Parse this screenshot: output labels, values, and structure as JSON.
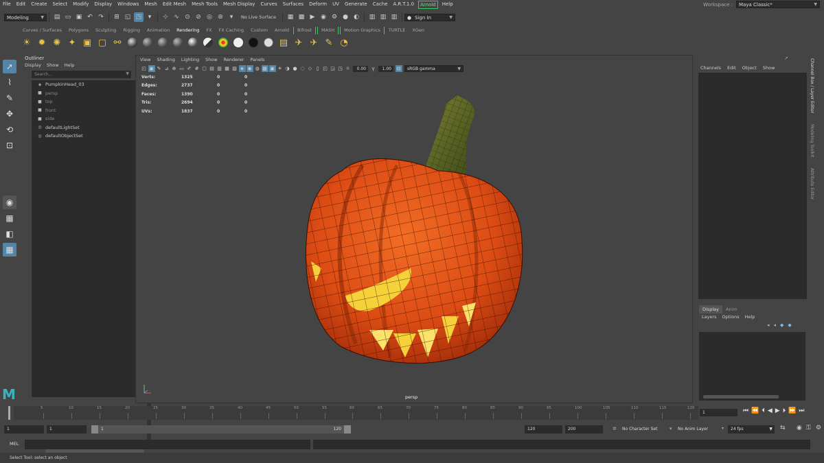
{
  "menubar": {
    "items": [
      "File",
      "Edit",
      "Create",
      "Select",
      "Modify",
      "Display",
      "Windows",
      "Mesh",
      "Edit Mesh",
      "Mesh Tools",
      "Mesh Display",
      "Curves",
      "Surfaces",
      "Deform",
      "UV",
      "Generate",
      "Cache",
      "A.R.T.1.0"
    ],
    "arnold": "Arnold",
    "help": "Help",
    "workspace_label": "Workspace :",
    "workspace_value": "Maya Classic*"
  },
  "statusline": {
    "mode": "Modeling",
    "live_surface": "No Live Surface",
    "sign_in": "Sign In"
  },
  "shelf": {
    "tabs": [
      "Curves / Surfaces",
      "Polygons",
      "Sculpting",
      "Rigging",
      "Animation",
      "Rendering",
      "FX",
      "FX Caching",
      "Custom",
      "Arnold",
      "Bifrost",
      "MASH",
      "Motion Graphics",
      "TURTLE",
      "XGen"
    ],
    "active_tab": "Rendering"
  },
  "outliner": {
    "title": "Outliner",
    "menu": [
      "Display",
      "Show",
      "Help"
    ],
    "search_placeholder": "Search...",
    "items": [
      {
        "label": "PumpkinHead_03",
        "icon": "mesh-icon",
        "dim": false
      },
      {
        "label": "persp",
        "icon": "camera-icon",
        "dim": true
      },
      {
        "label": "top",
        "icon": "camera-icon",
        "dim": true
      },
      {
        "label": "front",
        "icon": "camera-icon",
        "dim": true
      },
      {
        "label": "side",
        "icon": "camera-icon",
        "dim": true
      },
      {
        "label": "defaultLightSet",
        "icon": "set-icon",
        "dim": false
      },
      {
        "label": "defaultObjectSet",
        "icon": "set-icon",
        "dim": false
      }
    ]
  },
  "viewport": {
    "menu": [
      "View",
      "Shading",
      "Lighting",
      "Show",
      "Renderer",
      "Panels"
    ],
    "exposure": "0.00",
    "gamma": "1.00",
    "color_space": "sRGB gamma",
    "hud": [
      {
        "label": "Verts:",
        "v1": "1325",
        "v2": "0",
        "v3": "0"
      },
      {
        "label": "Edges:",
        "v1": "2737",
        "v2": "0",
        "v3": "0"
      },
      {
        "label": "Faces:",
        "v1": "1390",
        "v2": "0",
        "v3": "0"
      },
      {
        "label": "Tris:",
        "v1": "2694",
        "v2": "0",
        "v3": "0"
      },
      {
        "label": "UVs:",
        "v1": "1837",
        "v2": "0",
        "v3": "0"
      }
    ],
    "camera": "persp"
  },
  "channelbox": {
    "menu": [
      "Channels",
      "Edit",
      "Object",
      "Show"
    ],
    "layer_tabs": [
      "Display",
      "Anim"
    ],
    "layer_menu": [
      "Layers",
      "Options",
      "Help"
    ]
  },
  "sidetabs": [
    "Channel Box / Layer Editor",
    "Modeling Toolkit",
    "Attribute Editor"
  ],
  "timeslider": {
    "ticks": [
      "5",
      "10",
      "15",
      "20",
      "25",
      "30",
      "35",
      "40",
      "45",
      "50",
      "55",
      "60",
      "65",
      "70",
      "75",
      "80",
      "85",
      "90",
      "95",
      "100",
      "105",
      "110",
      "115",
      "120"
    ],
    "current_frame": "1",
    "start_frame": "1"
  },
  "range": {
    "start": "1",
    "playback_start": "1",
    "range_start": "1",
    "range_end": "120",
    "end": "120",
    "anim_end": "200",
    "character_set": "No Character Set",
    "anim_layer": "No Anim Layer",
    "fps": "24 fps"
  },
  "mel_label": "MEL",
  "help_line": "Select Tool: select an object",
  "colors": {
    "accent": "#5285a6",
    "highlight": "#66e07c",
    "pumpkin": "#e0561a",
    "stem": "#5c6a2a",
    "glow": "#f6d23a"
  }
}
